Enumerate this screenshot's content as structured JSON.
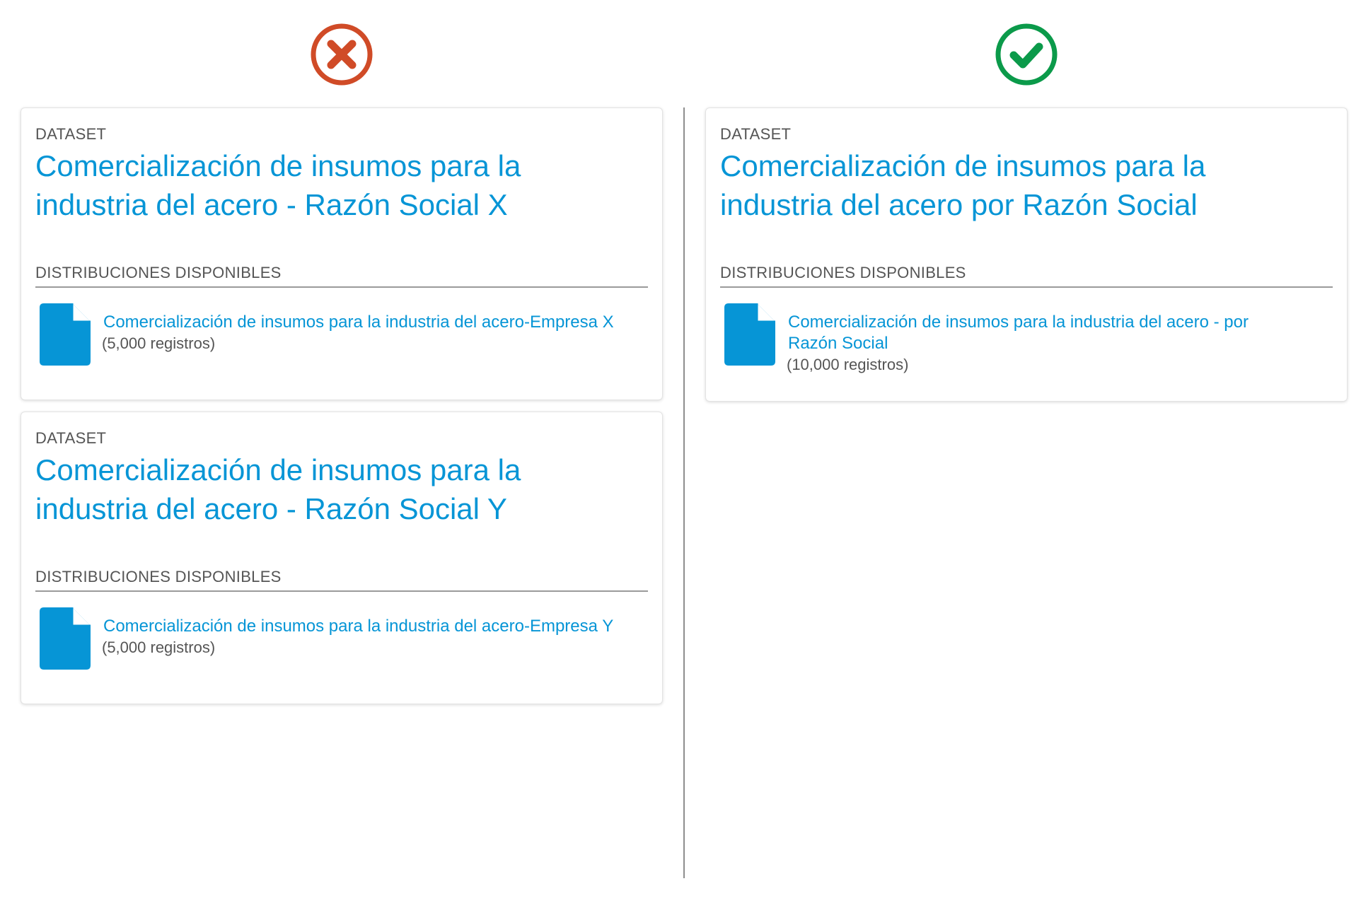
{
  "bad_example": {
    "verdict_icon": "cross-circle-icon",
    "verdict_color": "#d04b27",
    "cards": [
      {
        "label": "DATASET",
        "title": "Comercialización de insumos para la industria del acero - Razón Social X",
        "distributions_heading": "DISTRIBUCIONES DISPONIBLES",
        "distribution": {
          "icon": "file-icon",
          "name": "Comercialización de insumos para la industria del acero-Empresa X",
          "records": "(5,000 registros)"
        }
      },
      {
        "label": "DATASET",
        "title": "Comercialización de insumos para la industria del acero - Razón Social Y",
        "distributions_heading": "DISTRIBUCIONES DISPONIBLES",
        "distribution": {
          "icon": "file-icon",
          "name": "Comercialización de insumos para la industria del acero-Empresa Y",
          "records": "(5,000 registros)"
        }
      }
    ]
  },
  "good_example": {
    "verdict_icon": "check-circle-icon",
    "verdict_color": "#0b9a4a",
    "cards": [
      {
        "label": "DATASET",
        "title": "Comercialización de insumos para la industria del acero por Razón Social",
        "distributions_heading": "DISTRIBUCIONES DISPONIBLES",
        "distribution": {
          "icon": "file-icon",
          "name": "Comercialización de insumos para la industria del acero - por Razón Social",
          "records": "(10,000 registros)"
        }
      }
    ]
  },
  "colors": {
    "link": "#0695d6",
    "text": "#555555",
    "divider": "#8e8e8e"
  }
}
